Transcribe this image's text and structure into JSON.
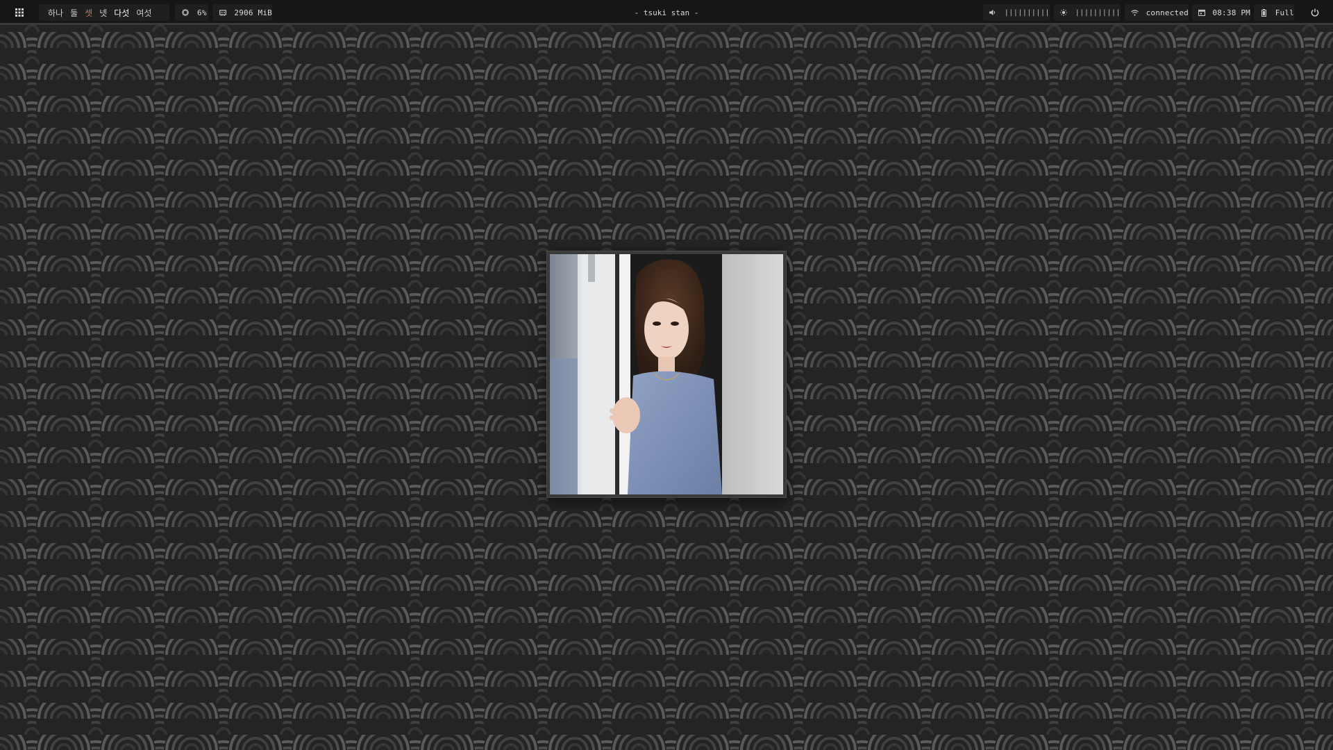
{
  "topbar": {
    "launcher_icon": "grid-icon",
    "workspaces": [
      "하나",
      "둘",
      "셋",
      "넷",
      "다섯",
      "여섯"
    ],
    "active_workspace_index": 2,
    "cpu": {
      "icon": "cpu-icon",
      "value": "6%"
    },
    "memory": {
      "icon": "memory-icon",
      "value": "2906 MiB"
    },
    "window_title": "- tsuki stan -",
    "volume": {
      "icon": "speaker-icon",
      "bars": "||||||||||"
    },
    "brightness": {
      "icon": "sun-icon",
      "bars": "||||||||||"
    },
    "network": {
      "icon": "wifi-icon",
      "status": "connected"
    },
    "clock": {
      "icon": "calendar-icon",
      "time": "08:38 PM"
    },
    "battery": {
      "icon": "battery-icon",
      "status": "Full"
    },
    "power_icon": "power-icon"
  },
  "colors": {
    "bar_bg": "#161616",
    "pill_bg": "#1f1f1f",
    "active_workspace": "#c07a6b",
    "wallpaper_bg": "#242424",
    "wallpaper_wave": "#5a5a5a"
  }
}
